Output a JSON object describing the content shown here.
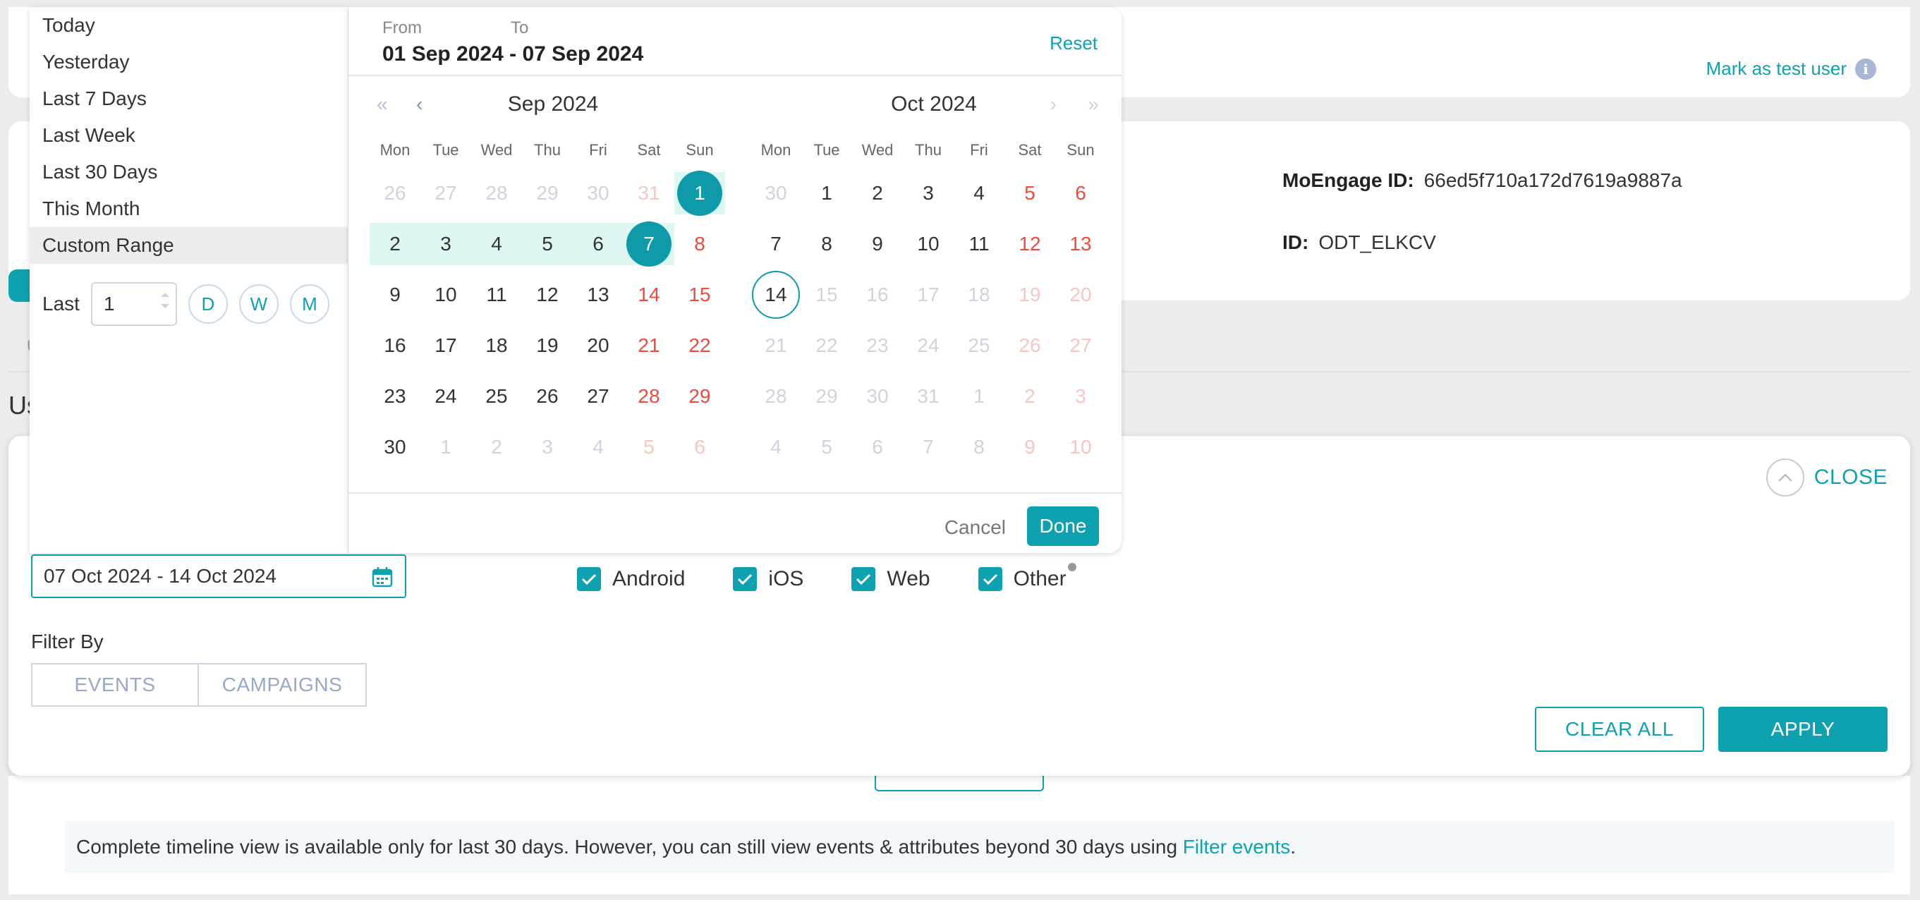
{
  "header": {
    "mark_test_user": "Mark as test user",
    "info_icon": "i"
  },
  "profile": {
    "moengage_id_label": "MoEngage ID:",
    "moengage_id_value": "66ed5f710a172d7619a9887a",
    "id_label": "ID:",
    "id_value": "ODT_ELKCV"
  },
  "fragments": {
    "tab_initial": "U",
    "section_initial": "Us"
  },
  "filter_panel": {
    "close_label": "CLOSE",
    "date_value": "07 Oct 2024 - 14 Oct 2024",
    "platforms": [
      "Android",
      "iOS",
      "Web",
      "Other"
    ],
    "filter_by_label": "Filter By",
    "segments": [
      "EVENTS",
      "CAMPAIGNS"
    ],
    "clear_all_label": "CLEAR ALL",
    "apply_label": "APPLY"
  },
  "notice": {
    "text": "Complete timeline view is available only for last 30 days. However, you can still view events & attributes beyond 30 days using ",
    "link": "Filter events",
    "end": "."
  },
  "date_picker": {
    "presets": [
      "Today",
      "Yesterday",
      "Last 7 Days",
      "Last Week",
      "Last 30 Days",
      "This Month",
      "Custom Range"
    ],
    "active_preset": "Custom Range",
    "last_label": "Last",
    "last_value": "1",
    "units": [
      "D",
      "W",
      "M"
    ],
    "from_label": "From",
    "to_label": "To",
    "range_value": "01 Sep 2024 - 07 Sep 2024",
    "reset_label": "Reset",
    "cancel_label": "Cancel",
    "done_label": "Done",
    "weekdays": [
      "Mon",
      "Tue",
      "Wed",
      "Thu",
      "Fri",
      "Sat",
      "Sun"
    ],
    "months": [
      {
        "title": "Sep 2024",
        "weeks": [
          [
            "26",
            "27",
            "28",
            "29",
            "30",
            "31",
            "1"
          ],
          [
            "2",
            "3",
            "4",
            "5",
            "6",
            "7",
            "8"
          ],
          [
            "9",
            "10",
            "11",
            "12",
            "13",
            "14",
            "15"
          ],
          [
            "16",
            "17",
            "18",
            "19",
            "20",
            "21",
            "22"
          ],
          [
            "23",
            "24",
            "25",
            "26",
            "27",
            "28",
            "29"
          ],
          [
            "30",
            "1",
            "2",
            "3",
            "4",
            "5",
            "6"
          ]
        ]
      },
      {
        "title": "Oct 2024",
        "weeks": [
          [
            "30",
            "1",
            "2",
            "3",
            "4",
            "5",
            "6"
          ],
          [
            "7",
            "8",
            "9",
            "10",
            "11",
            "12",
            "13"
          ],
          [
            "14",
            "15",
            "16",
            "17",
            "18",
            "19",
            "20"
          ],
          [
            "21",
            "22",
            "23",
            "24",
            "25",
            "26",
            "27"
          ],
          [
            "28",
            "29",
            "30",
            "31",
            "1",
            "2",
            "3"
          ],
          [
            "4",
            "5",
            "6",
            "7",
            "8",
            "9",
            "10"
          ]
        ]
      }
    ]
  }
}
